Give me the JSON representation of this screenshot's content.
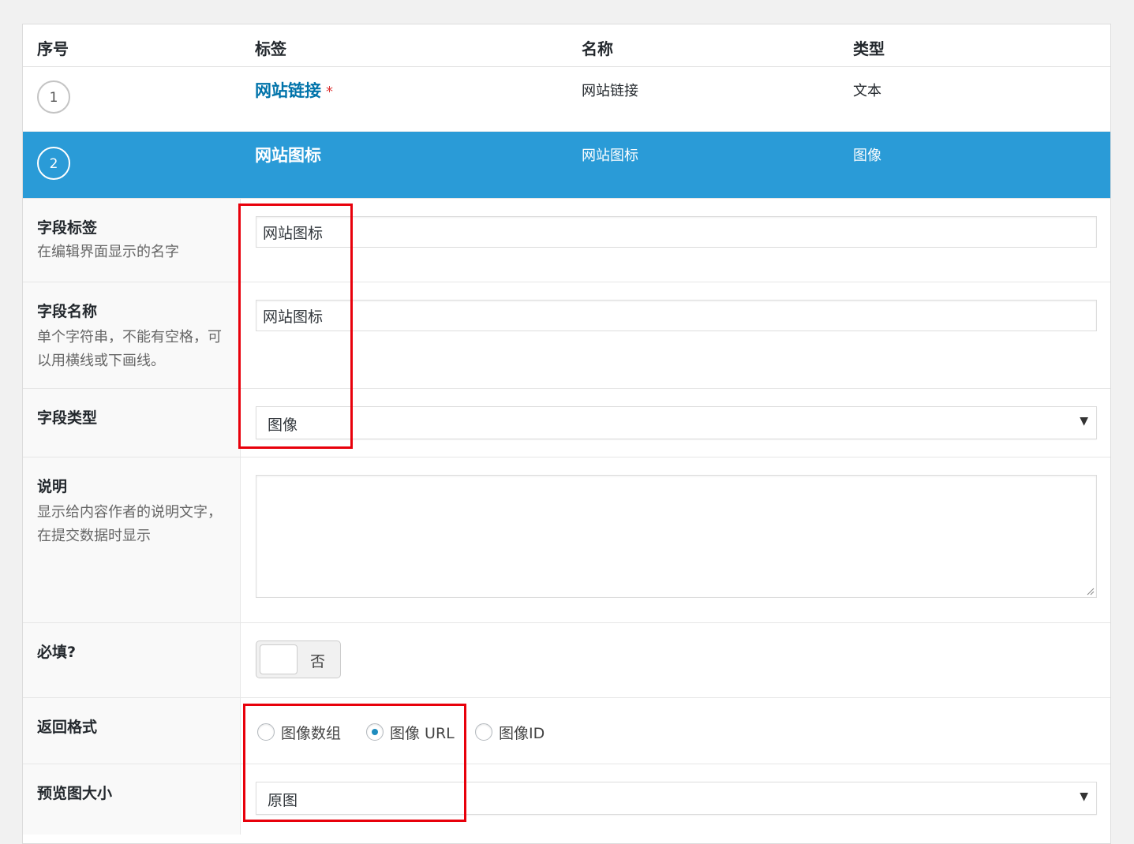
{
  "table_header": {
    "col_order": "序号",
    "col_label": "标签",
    "col_name": "名称",
    "col_type": "类型"
  },
  "fields": [
    {
      "order": "1",
      "label": "网站链接",
      "required_mark": "*",
      "name": "网站链接",
      "type": "文本"
    },
    {
      "order": "2",
      "label": "网站图标",
      "name": "网站图标",
      "type": "图像"
    }
  ],
  "settings": {
    "field_label": {
      "title": "字段标签",
      "desc": "在编辑界面显示的名字",
      "value": "网站图标"
    },
    "field_name": {
      "title": "字段名称",
      "desc": "单个字符串，不能有空格，可以用横线或下画线。",
      "value": "网站图标"
    },
    "field_type": {
      "title": "字段类型",
      "value": "图像"
    },
    "instructions": {
      "title": "说明",
      "desc": "显示给内容作者的说明文字，在提交数据时显示",
      "value": ""
    },
    "required": {
      "title": "必填?",
      "toggle_text": "否"
    },
    "return_format": {
      "title": "返回格式",
      "options": [
        "图像数组",
        "图像 URL",
        "图像ID"
      ],
      "selected": "图像 URL"
    },
    "preview_size": {
      "title": "预览图大小",
      "value": "原图"
    }
  },
  "colors": {
    "active_row": "#2a9bd7",
    "link": "#0073aa",
    "highlight_box": "#e8000b"
  },
  "icons": {
    "select_arrow": "dropdown-arrow-icon"
  }
}
